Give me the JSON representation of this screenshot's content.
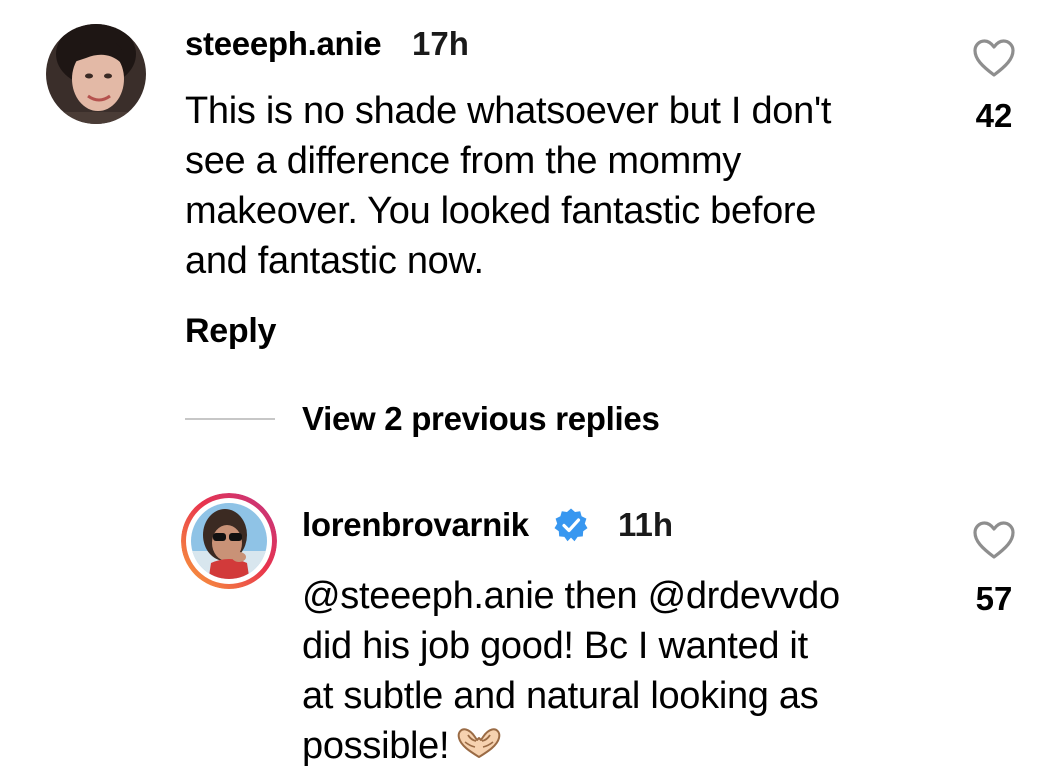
{
  "comment": {
    "username": "steeeph.anie",
    "time": "17h",
    "text_lines": [
      "This is no shade whatsoever but I don't",
      "see a difference from the mommy",
      "makeover. You looked fantastic before",
      "and fantastic now."
    ],
    "reply_label": "Reply",
    "like_count": "42"
  },
  "thread": {
    "view_replies_label": "View 2 previous replies"
  },
  "reply": {
    "username": "lorenbrovarnik",
    "time": "11h",
    "verified": true,
    "text_lines": [
      "@steeeph.anie then @drdevvdo",
      "did his job good! Bc I wanted it",
      "at subtle and natural looking as",
      "possible!"
    ],
    "emoji": "heart-hands-emoji",
    "like_count": "57"
  },
  "colors": {
    "text": "#000000",
    "divider": "#c7c7c7",
    "verified_badge": "#3897f0",
    "heart_outline": "#8e8e8e",
    "story_ring_start": "#f9a33b",
    "story_ring_end": "#d62976"
  }
}
